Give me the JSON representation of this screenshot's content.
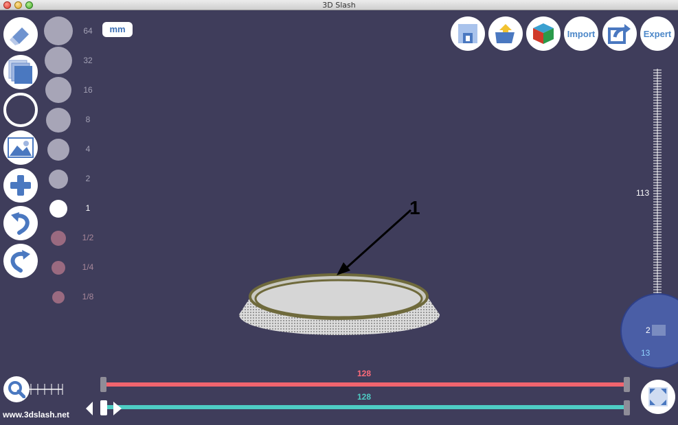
{
  "window": {
    "title": "3D Slash"
  },
  "tools": [
    {
      "name": "edit-tool",
      "icon": "pencil-eraser-icon"
    },
    {
      "name": "layers-tool",
      "icon": "stacked-squares-icon"
    },
    {
      "name": "shape-tool",
      "icon": "circle-outline-icon"
    },
    {
      "name": "image-tool",
      "icon": "image-icon"
    },
    {
      "name": "add-tool",
      "icon": "plus-icon"
    },
    {
      "name": "undo-tool",
      "icon": "undo-arrow-icon"
    },
    {
      "name": "redo-tool",
      "icon": "redo-arrow-icon"
    }
  ],
  "sizes": [
    "64",
    "32",
    "16",
    "8",
    "4",
    "2",
    "1",
    "1/2",
    "1/4",
    "1/8"
  ],
  "active_size": "1",
  "unit": "mm",
  "top_buttons": {
    "save_icon": "save-icon",
    "open_icon": "open-folder-icon",
    "cube_icon": "colored-cube-icon",
    "import_label": "Import",
    "share_icon": "share-icon",
    "expert_label": "Expert"
  },
  "ruler": {
    "label": "113",
    "knob_value": "2",
    "knob_value2": "13"
  },
  "sliders": {
    "top_value": "128",
    "bottom_value": "128"
  },
  "annotation": "1",
  "website": "www.3dslash.net",
  "colors": {
    "background": "#3f3d5b",
    "red_slider": "#f0646e",
    "cyan_slider": "#4ecdc4",
    "accent": "#4c87c8"
  }
}
